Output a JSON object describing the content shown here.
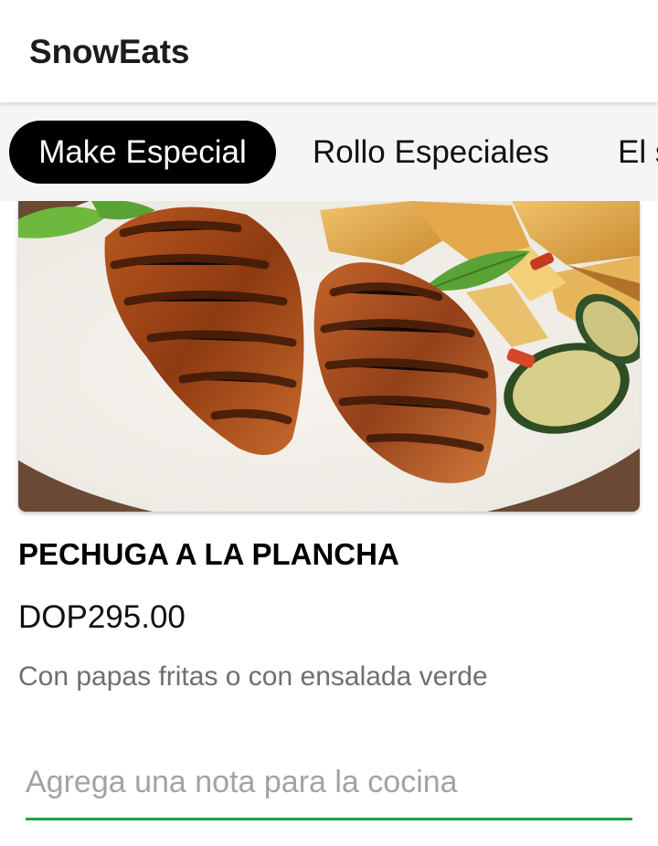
{
  "app": {
    "title": "SnowEats"
  },
  "tabs": [
    {
      "label": "Make Especial",
      "active": true
    },
    {
      "label": "Rollo Especiales",
      "active": false
    },
    {
      "label": "El s",
      "active": false
    }
  ],
  "product": {
    "image_icon": "grilled-chicken-photo",
    "name": "PECHUGA A LA PLANCHA",
    "price": "DOP295.00",
    "description": "Con papas fritas o con ensalada verde"
  },
  "note": {
    "placeholder": "Agrega una nota para la cocina",
    "value": ""
  },
  "colors": {
    "accent": "#1aa34a",
    "active_tab_bg": "#000000",
    "tab_bar_bg": "#f5f5f5"
  }
}
